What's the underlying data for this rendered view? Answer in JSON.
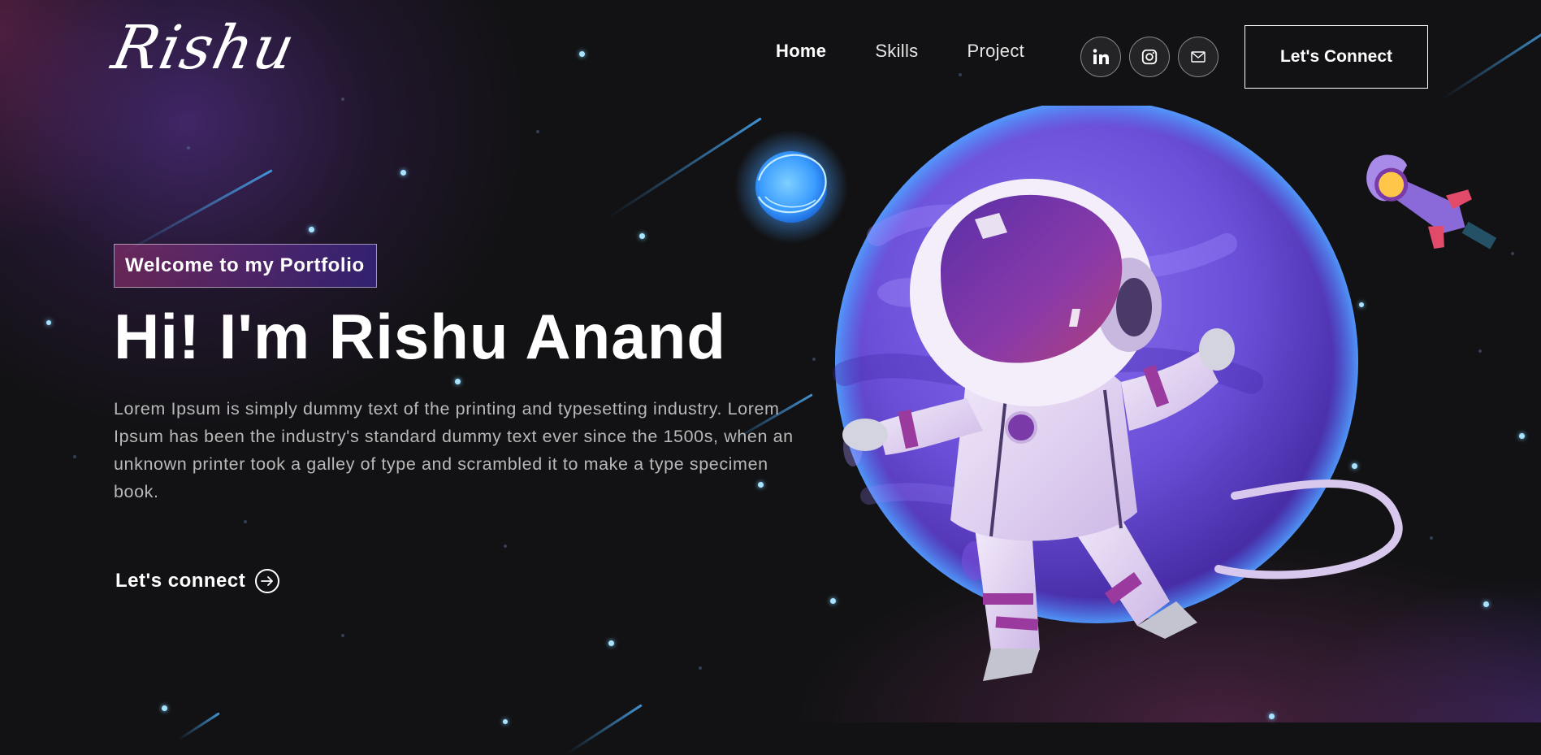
{
  "nav": {
    "logo": "Rishu",
    "links": [
      "Home",
      "Skills",
      "Project"
    ],
    "active": "Home",
    "socials": [
      {
        "icon": "linkedin-icon"
      },
      {
        "icon": "instagram-icon"
      },
      {
        "icon": "mail-icon"
      }
    ],
    "connect_label": "Let's Connect"
  },
  "hero": {
    "tagline": "Welcome to my Portfolio",
    "title": "Hi! I'm Rishu Anand",
    "description": "Lorem Ipsum is simply dummy text of the printing and typesetting industry. Lorem Ipsum has been the industry's standard dummy text ever since the 1500s, when an unknown printer took a galley of type and scrambled it to make a type specimen book.",
    "cta_label": "Let's connect",
    "cta_icon": "arrow-right-circle-icon"
  },
  "illustration": {
    "subject": "astronaut-planet-rocket",
    "colors": {
      "planet": "#6b4fd8",
      "planet_dark": "#4a2fa8",
      "suit": "#e8dcf0",
      "suit_stripe": "#9b3a9e",
      "visor": "#7a3aa8",
      "glow_orb": "#4ab0ff",
      "rocket": "#8a6ad8"
    }
  },
  "colors": {
    "background": "#121214",
    "text": "#ffffff",
    "muted_text": "#b8b8b8",
    "star": "#a8e4ff",
    "tagline_gradient": [
      "#aa367c",
      "#4a2fbd"
    ]
  }
}
